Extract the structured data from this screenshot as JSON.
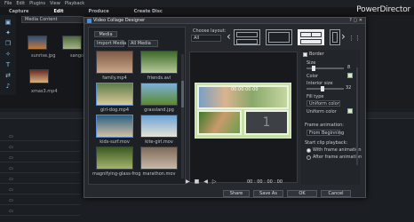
{
  "app": {
    "brand": "PowerDirector",
    "menu": [
      "File",
      "Edit",
      "Plugins",
      "View",
      "Playback"
    ],
    "modes": [
      "Capture",
      "Edit",
      "Produce",
      "Create Disc"
    ]
  },
  "library": {
    "content_select": "Media Content",
    "items": [
      {
        "label": "sunrise.jpg"
      },
      {
        "label": "sangol"
      },
      {
        "label": "xmas3.mp4"
      }
    ]
  },
  "dialog": {
    "title": "Video Collage Designer",
    "controls": "? ▢ ✕",
    "choose_layout_label": "Choose layout:",
    "layout_value": "All",
    "tab_media": "Media",
    "import_label": "Import Media",
    "all_media_label": "All Media",
    "media": [
      {
        "label": "family.mp4"
      },
      {
        "label": "friends.avi"
      },
      {
        "label": "girl-dog.mp4"
      },
      {
        "label": "grassland.jpg"
      },
      {
        "label": "kids-surf.mov"
      },
      {
        "label": "kite-girl.mov"
      },
      {
        "label": "magnifying-glass-frog"
      },
      {
        "label": "marathon.mov"
      }
    ],
    "preview_time": "00:00:00:00",
    "preview_slot_number": "1",
    "timecode": "00 : 00 : 00 : 00",
    "settings": {
      "border": "Border",
      "size_label": "Size",
      "size_value": "8",
      "color_label": "Color",
      "interior_size_label": "Interior size",
      "interior_size_value": "32",
      "fill_type_label": "Fill type",
      "fill_type_value": "Uniform color",
      "uniform_color_label": "Uniform color",
      "frame_animation_label": "Frame animation:",
      "frame_animation_value": "From Beginning",
      "start_playback_label": "Start clip playback:",
      "option_with": "With frame animation",
      "option_after": "After frame animation"
    },
    "buttons": {
      "share": "Share",
      "save_as": "Save As",
      "ok": "OK",
      "cancel": "Cancel"
    }
  },
  "colors": {
    "border_color": "#d8ecbf",
    "accent": "#5b8fd1"
  }
}
